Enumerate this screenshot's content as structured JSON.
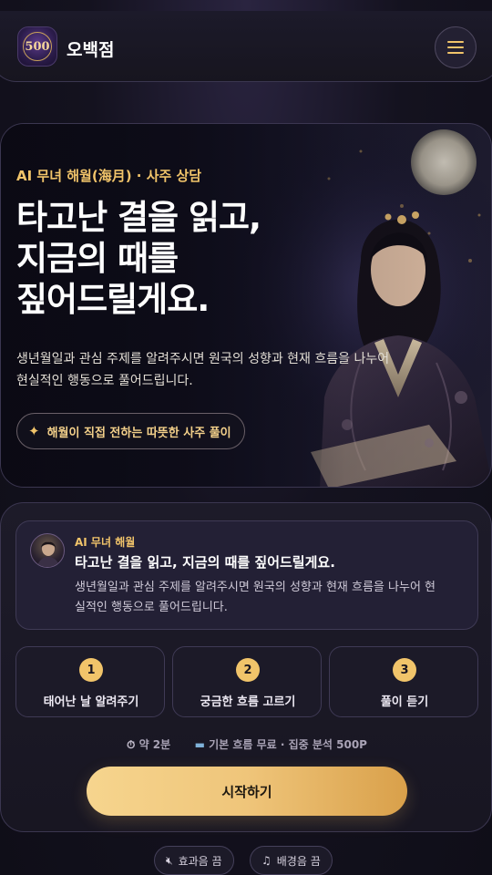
{
  "header": {
    "logo_text": "500",
    "brand": "오백점",
    "menu_icon": "hamburger-menu-icon"
  },
  "hero": {
    "eyebrow": "AI 무녀 해월(海月) · 사주 상담",
    "title_lines": [
      "타고난 결을 읽고,",
      "지금의 때를",
      "짚어드릴게요."
    ],
    "desc_lines": [
      "생년월일과 관심 주제를 알려주시면 원국의 성향과 현재 흐름을 나누어",
      "현실적인 행동으로 풀어드립니다."
    ],
    "chip_label": "해월이 직접 전하는 따뜻한 사주 풀이",
    "chip_icon": "sparkle-icon"
  },
  "message": {
    "name": "AI 무녀 해월",
    "title": "타고난 결을 읽고, 지금의 때를 짚어드릴게요.",
    "body_lines": [
      "생년월일과 관심 주제를 알려주시면 원국의 성향과 현재 흐름을 나누어 현",
      "실적인 행동으로 풀어드립니다."
    ]
  },
  "steps": [
    {
      "num": "1",
      "label": "태어난 날 알려주기"
    },
    {
      "num": "2",
      "label": "궁금한 흐름 고르기"
    },
    {
      "num": "3",
      "label": "풀이 듣기"
    }
  ],
  "meta": {
    "time_icon": "stopwatch-icon",
    "time": "약 2분",
    "price_icon": "card-icon",
    "price": "기본 흐름 무료 · 집중 분석 500P"
  },
  "start_label": "시작하기",
  "toggles": {
    "sfx_icon": "speaker-muted-icon",
    "sfx": "효과음 끔",
    "bgm_icon": "music-note-icon",
    "bgm": "배경음 끔"
  },
  "colors": {
    "accent": "#f1c46a",
    "background": "#14121f",
    "button_gradient_start": "#f6d58e",
    "button_gradient_end": "#d9a04a"
  }
}
